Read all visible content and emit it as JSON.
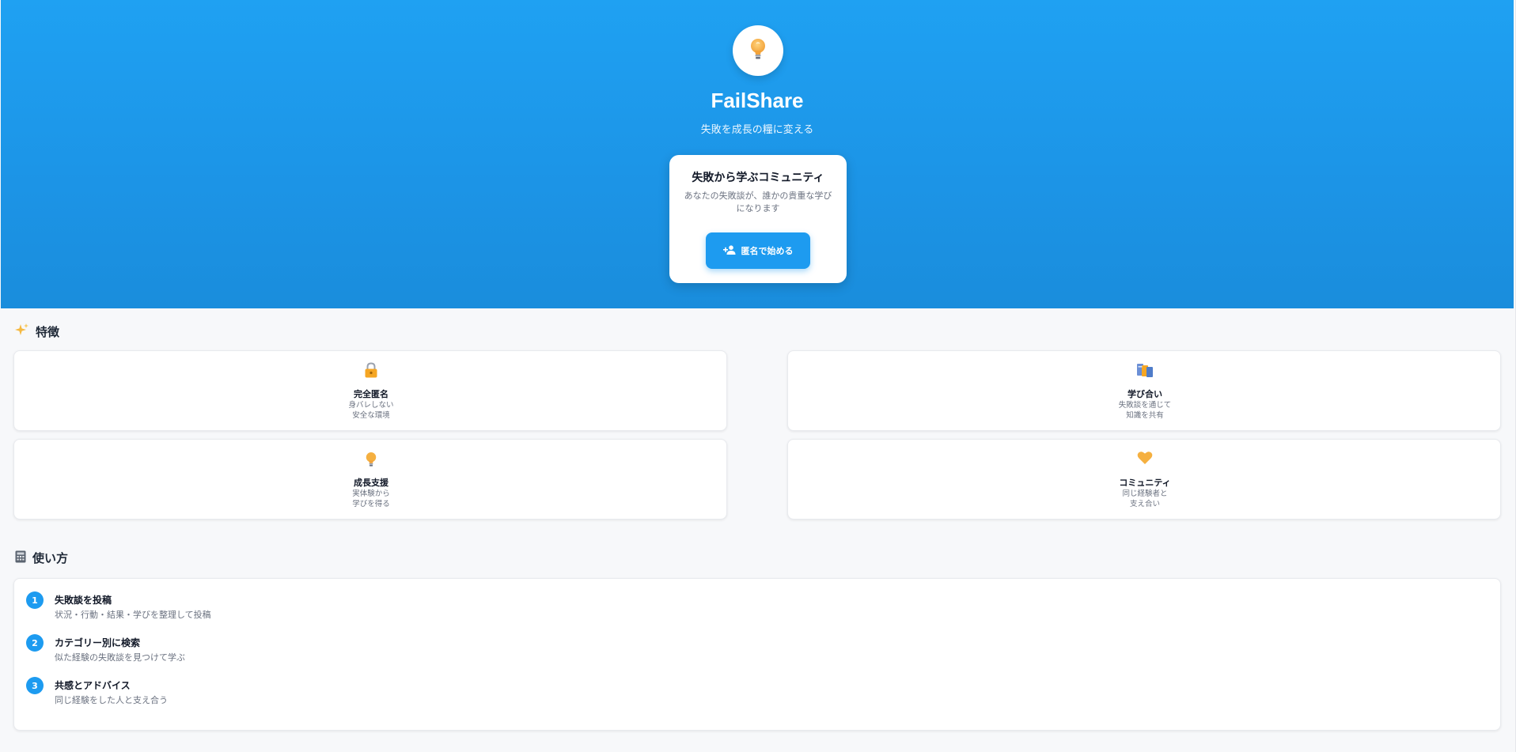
{
  "hero": {
    "logo_icon": "lightbulb-icon",
    "title": "FailShare",
    "tagline": "失敗を成長の糧に変える",
    "card": {
      "title": "失敗から学ぶコミュニティ",
      "description": "あなたの失敗談が、誰かの貴重な学びになります",
      "button_icon": "person-add-icon",
      "button_label": "匿名で始める"
    }
  },
  "features": {
    "heading_icon": "sparkles-icon",
    "heading": "特徴",
    "items": [
      {
        "icon": "lock-icon",
        "title": "完全匿名",
        "line1": "身バレしない",
        "line2": "安全な環境"
      },
      {
        "icon": "books-icon",
        "title": "学び合い",
        "line1": "失敗談を通じて",
        "line2": "知識を共有"
      },
      {
        "icon": "lightbulb-icon",
        "title": "成長支援",
        "line1": "実体験から",
        "line2": "学びを得る"
      },
      {
        "icon": "heart-icon",
        "title": "コミュニティ",
        "line1": "同じ経験者と",
        "line2": "支え合い"
      }
    ]
  },
  "how_to": {
    "heading_icon": "calculator-icon",
    "heading": "使い方",
    "steps": [
      {
        "number": "1",
        "title": "失敗談を投稿",
        "description": "状況・行動・結果・学びを整理して投稿"
      },
      {
        "number": "2",
        "title": "カテゴリー別に検索",
        "description": "似た経験の失敗談を見つけて学ぶ"
      },
      {
        "number": "3",
        "title": "共感とアドバイス",
        "description": "同じ経験をした人と支え合う"
      }
    ]
  },
  "colors": {
    "primary": "#1d9bf0",
    "background": "#f7f8fa",
    "accent_icon": "#f5a623"
  }
}
